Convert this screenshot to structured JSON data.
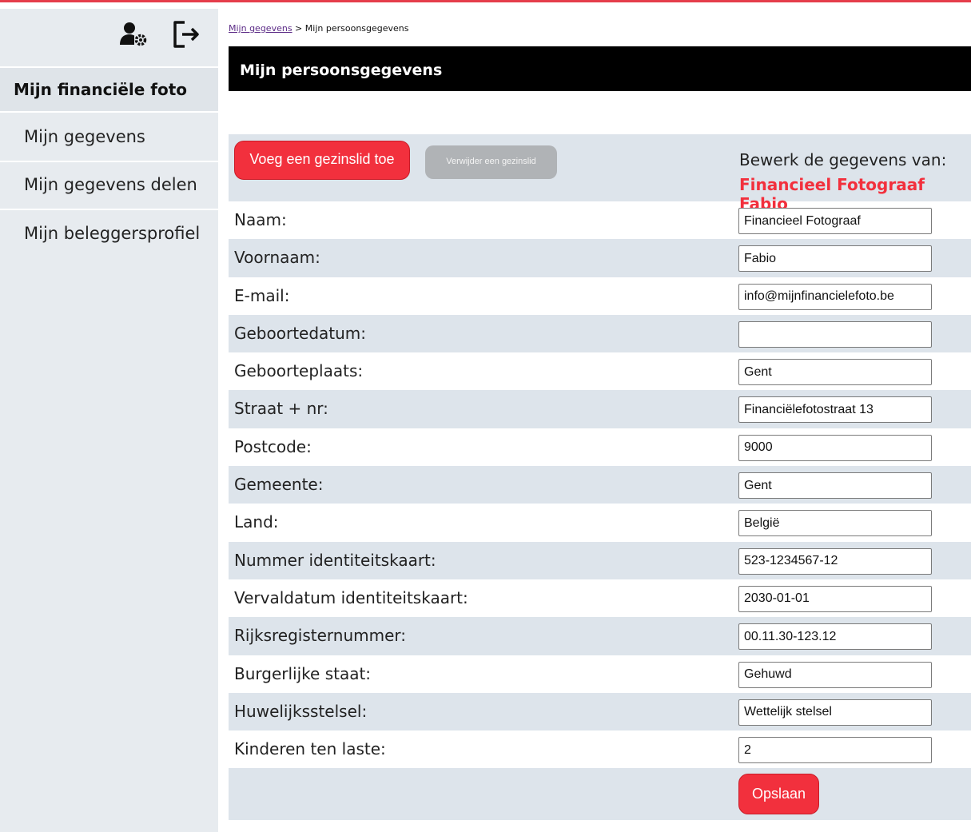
{
  "sidebar": {
    "icons": [
      "user-settings-icon",
      "logout-icon"
    ],
    "title": "Mijn financiële foto",
    "items": [
      {
        "label": "Mijn gegevens"
      },
      {
        "label": "Mijn gegevens delen"
      },
      {
        "label": "Mijn beleggersprofiel"
      }
    ]
  },
  "breadcrumb": {
    "link": "Mijn gegevens",
    "separator": " > ",
    "current": "Mijn persoonsgegevens"
  },
  "page": {
    "title": "Mijn persoonsgegevens"
  },
  "toolbar": {
    "add_member": "Voeg een gezinslid toe",
    "remove_member": "Verwijder een gezinslid",
    "edit_label": "Bewerk de gegevens van:",
    "edit_name": "Financieel Fotograaf Fabio"
  },
  "fields": [
    {
      "label": "Naam:",
      "value": "Financieel Fotograaf"
    },
    {
      "label": "Voornaam:",
      "value": "Fabio"
    },
    {
      "label": "E-mail:",
      "value": "info@mijnfinancielefoto.be"
    },
    {
      "label": "Geboortedatum:",
      "value": ""
    },
    {
      "label": "Geboorteplaats:",
      "value": "Gent"
    },
    {
      "label": "Straat + nr:",
      "value": "Financiëlefotostraat 13"
    },
    {
      "label": "Postcode:",
      "value": "9000"
    },
    {
      "label": "Gemeente:",
      "value": "Gent"
    },
    {
      "label": "Land:",
      "value": "België"
    },
    {
      "label": "Nummer identiteitskaart:",
      "value": "523-1234567-12"
    },
    {
      "label": "Vervaldatum identiteitskaart:",
      "value": "2030-01-01"
    },
    {
      "label": "Rijksregisternummer:",
      "value": "00.11.30-123.12"
    },
    {
      "label": "Burgerlijke staat:",
      "value": "Gehuwd"
    },
    {
      "label": "Huwelijksstelsel:",
      "value": "Wettelijk stelsel"
    },
    {
      "label": "Kinderen ten laste:",
      "value": "2"
    }
  ],
  "save_label": "Opslaan",
  "colors": {
    "accent": "#f2303d",
    "sidebar_bg": "#e7ebef",
    "row_alt": "#dde4eb",
    "top_line": "#e53d4b"
  }
}
